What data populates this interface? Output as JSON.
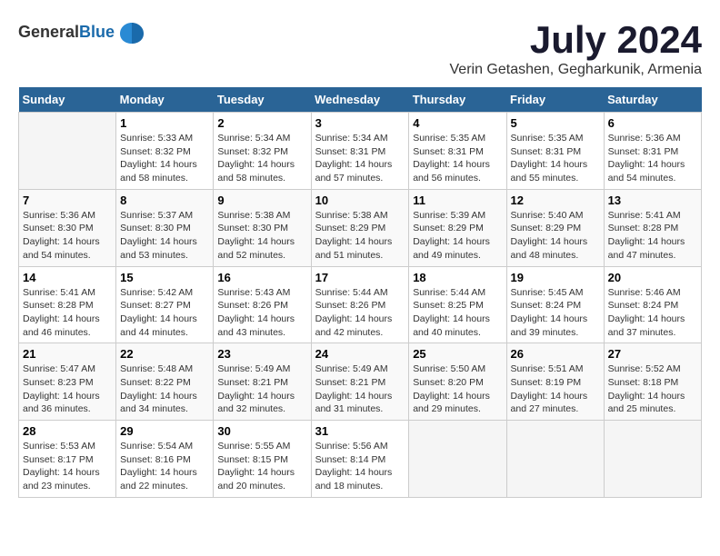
{
  "header": {
    "logo": {
      "general": "General",
      "blue": "Blue"
    },
    "title": "July 2024",
    "location": "Verin Getashen, Gegharkunik, Armenia"
  },
  "calendar": {
    "days_of_week": [
      "Sunday",
      "Monday",
      "Tuesday",
      "Wednesday",
      "Thursday",
      "Friday",
      "Saturday"
    ],
    "weeks": [
      [
        {
          "day": "",
          "sunrise": "",
          "sunset": "",
          "daylight": ""
        },
        {
          "day": "1",
          "sunrise": "Sunrise: 5:33 AM",
          "sunset": "Sunset: 8:32 PM",
          "daylight": "Daylight: 14 hours and 58 minutes."
        },
        {
          "day": "2",
          "sunrise": "Sunrise: 5:34 AM",
          "sunset": "Sunset: 8:32 PM",
          "daylight": "Daylight: 14 hours and 58 minutes."
        },
        {
          "day": "3",
          "sunrise": "Sunrise: 5:34 AM",
          "sunset": "Sunset: 8:31 PM",
          "daylight": "Daylight: 14 hours and 57 minutes."
        },
        {
          "day": "4",
          "sunrise": "Sunrise: 5:35 AM",
          "sunset": "Sunset: 8:31 PM",
          "daylight": "Daylight: 14 hours and 56 minutes."
        },
        {
          "day": "5",
          "sunrise": "Sunrise: 5:35 AM",
          "sunset": "Sunset: 8:31 PM",
          "daylight": "Daylight: 14 hours and 55 minutes."
        },
        {
          "day": "6",
          "sunrise": "Sunrise: 5:36 AM",
          "sunset": "Sunset: 8:31 PM",
          "daylight": "Daylight: 14 hours and 54 minutes."
        }
      ],
      [
        {
          "day": "7",
          "sunrise": "Sunrise: 5:36 AM",
          "sunset": "Sunset: 8:30 PM",
          "daylight": "Daylight: 14 hours and 54 minutes."
        },
        {
          "day": "8",
          "sunrise": "Sunrise: 5:37 AM",
          "sunset": "Sunset: 8:30 PM",
          "daylight": "Daylight: 14 hours and 53 minutes."
        },
        {
          "day": "9",
          "sunrise": "Sunrise: 5:38 AM",
          "sunset": "Sunset: 8:30 PM",
          "daylight": "Daylight: 14 hours and 52 minutes."
        },
        {
          "day": "10",
          "sunrise": "Sunrise: 5:38 AM",
          "sunset": "Sunset: 8:29 PM",
          "daylight": "Daylight: 14 hours and 51 minutes."
        },
        {
          "day": "11",
          "sunrise": "Sunrise: 5:39 AM",
          "sunset": "Sunset: 8:29 PM",
          "daylight": "Daylight: 14 hours and 49 minutes."
        },
        {
          "day": "12",
          "sunrise": "Sunrise: 5:40 AM",
          "sunset": "Sunset: 8:29 PM",
          "daylight": "Daylight: 14 hours and 48 minutes."
        },
        {
          "day": "13",
          "sunrise": "Sunrise: 5:41 AM",
          "sunset": "Sunset: 8:28 PM",
          "daylight": "Daylight: 14 hours and 47 minutes."
        }
      ],
      [
        {
          "day": "14",
          "sunrise": "Sunrise: 5:41 AM",
          "sunset": "Sunset: 8:28 PM",
          "daylight": "Daylight: 14 hours and 46 minutes."
        },
        {
          "day": "15",
          "sunrise": "Sunrise: 5:42 AM",
          "sunset": "Sunset: 8:27 PM",
          "daylight": "Daylight: 14 hours and 44 minutes."
        },
        {
          "day": "16",
          "sunrise": "Sunrise: 5:43 AM",
          "sunset": "Sunset: 8:26 PM",
          "daylight": "Daylight: 14 hours and 43 minutes."
        },
        {
          "day": "17",
          "sunrise": "Sunrise: 5:44 AM",
          "sunset": "Sunset: 8:26 PM",
          "daylight": "Daylight: 14 hours and 42 minutes."
        },
        {
          "day": "18",
          "sunrise": "Sunrise: 5:44 AM",
          "sunset": "Sunset: 8:25 PM",
          "daylight": "Daylight: 14 hours and 40 minutes."
        },
        {
          "day": "19",
          "sunrise": "Sunrise: 5:45 AM",
          "sunset": "Sunset: 8:24 PM",
          "daylight": "Daylight: 14 hours and 39 minutes."
        },
        {
          "day": "20",
          "sunrise": "Sunrise: 5:46 AM",
          "sunset": "Sunset: 8:24 PM",
          "daylight": "Daylight: 14 hours and 37 minutes."
        }
      ],
      [
        {
          "day": "21",
          "sunrise": "Sunrise: 5:47 AM",
          "sunset": "Sunset: 8:23 PM",
          "daylight": "Daylight: 14 hours and 36 minutes."
        },
        {
          "day": "22",
          "sunrise": "Sunrise: 5:48 AM",
          "sunset": "Sunset: 8:22 PM",
          "daylight": "Daylight: 14 hours and 34 minutes."
        },
        {
          "day": "23",
          "sunrise": "Sunrise: 5:49 AM",
          "sunset": "Sunset: 8:21 PM",
          "daylight": "Daylight: 14 hours and 32 minutes."
        },
        {
          "day": "24",
          "sunrise": "Sunrise: 5:49 AM",
          "sunset": "Sunset: 8:21 PM",
          "daylight": "Daylight: 14 hours and 31 minutes."
        },
        {
          "day": "25",
          "sunrise": "Sunrise: 5:50 AM",
          "sunset": "Sunset: 8:20 PM",
          "daylight": "Daylight: 14 hours and 29 minutes."
        },
        {
          "day": "26",
          "sunrise": "Sunrise: 5:51 AM",
          "sunset": "Sunset: 8:19 PM",
          "daylight": "Daylight: 14 hours and 27 minutes."
        },
        {
          "day": "27",
          "sunrise": "Sunrise: 5:52 AM",
          "sunset": "Sunset: 8:18 PM",
          "daylight": "Daylight: 14 hours and 25 minutes."
        }
      ],
      [
        {
          "day": "28",
          "sunrise": "Sunrise: 5:53 AM",
          "sunset": "Sunset: 8:17 PM",
          "daylight": "Daylight: 14 hours and 23 minutes."
        },
        {
          "day": "29",
          "sunrise": "Sunrise: 5:54 AM",
          "sunset": "Sunset: 8:16 PM",
          "daylight": "Daylight: 14 hours and 22 minutes."
        },
        {
          "day": "30",
          "sunrise": "Sunrise: 5:55 AM",
          "sunset": "Sunset: 8:15 PM",
          "daylight": "Daylight: 14 hours and 20 minutes."
        },
        {
          "day": "31",
          "sunrise": "Sunrise: 5:56 AM",
          "sunset": "Sunset: 8:14 PM",
          "daylight": "Daylight: 14 hours and 18 minutes."
        },
        {
          "day": "",
          "sunrise": "",
          "sunset": "",
          "daylight": ""
        },
        {
          "day": "",
          "sunrise": "",
          "sunset": "",
          "daylight": ""
        },
        {
          "day": "",
          "sunrise": "",
          "sunset": "",
          "daylight": ""
        }
      ]
    ]
  }
}
